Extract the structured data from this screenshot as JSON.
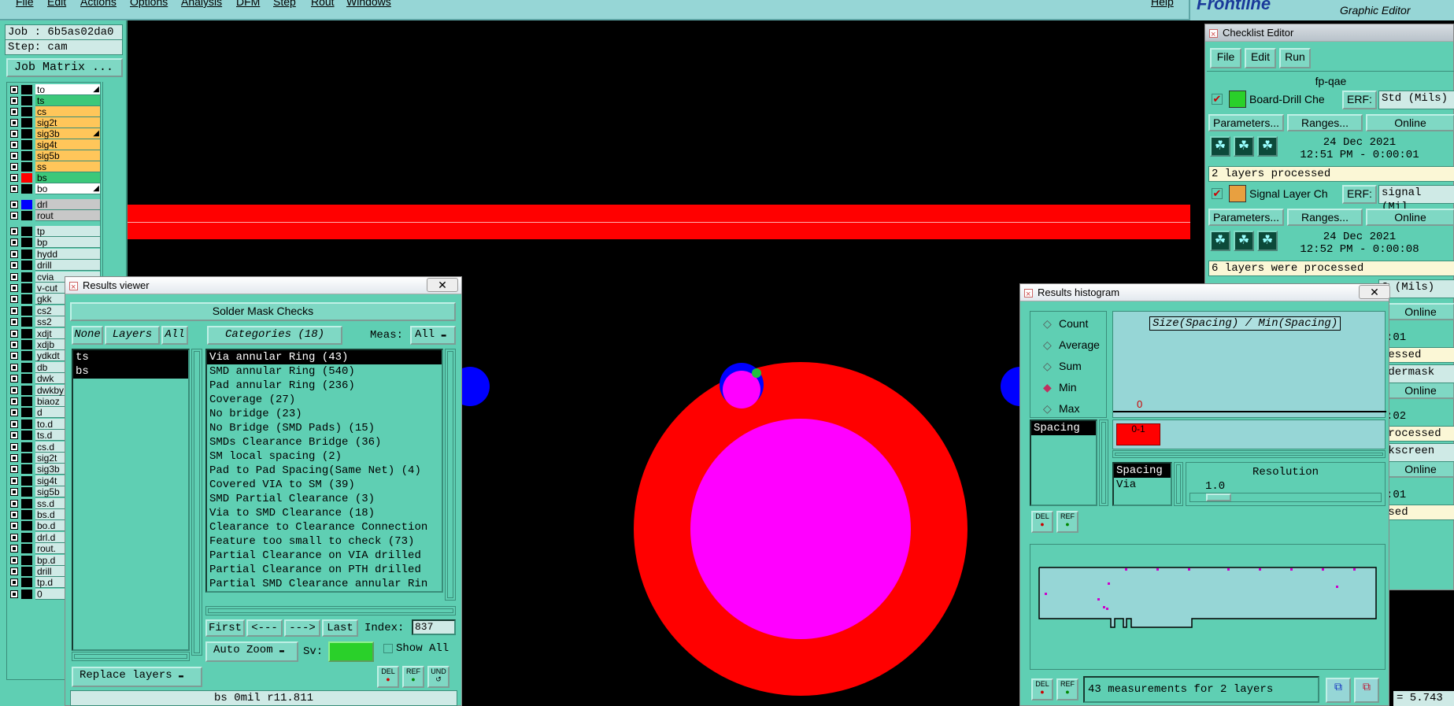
{
  "menu": [
    "File",
    "Edit",
    "Actions",
    "Options",
    "Analysis",
    "DFM",
    "Step",
    "Rout",
    "Windows",
    "Help"
  ],
  "brand": {
    "logo": "Frontline",
    "subtitle": "Graphic Editor"
  },
  "job": {
    "job_label": "Job : 6b5as02da0",
    "step_label": "Step: cam",
    "matrix_button": "Job Matrix ..."
  },
  "layers": [
    {
      "name": "to",
      "color": "#ffffff",
      "marker": "◢"
    },
    {
      "name": "ts",
      "color": "#3cc87a",
      "marker": ""
    },
    {
      "name": "cs",
      "color": "#ffc65a",
      "marker": ""
    },
    {
      "name": "sig2t",
      "color": "#ffc65a",
      "marker": ""
    },
    {
      "name": "sig3b",
      "color": "#ffc65a",
      "marker": "◢"
    },
    {
      "name": "sig4t",
      "color": "#ffc65a",
      "marker": ""
    },
    {
      "name": "sig5b",
      "color": "#ffc65a",
      "marker": ""
    },
    {
      "name": "ss",
      "color": "#ffc65a",
      "marker": ""
    },
    {
      "name": "bs",
      "color": "#3cc87a",
      "marker": ""
    },
    {
      "name": "bo",
      "color": "#ffffff",
      "marker": "◢"
    }
  ],
  "drill_layers": [
    {
      "name": "drl",
      "color": "#c8c8c8"
    },
    {
      "name": "rout",
      "color": "#c8c8c8"
    }
  ],
  "misc_layers": [
    "tp",
    "bp",
    "hydd",
    "drill",
    "cvia",
    "v-cut",
    "gkk",
    "cs2",
    "ss2",
    "xdjt",
    "xdjb",
    "ydkdt",
    "db",
    "dwk",
    "dwkby",
    "biaoz",
    "d",
    "to.d",
    "ts.d",
    "cs.d",
    "sig2t",
    "sig3b",
    "sig4t",
    "sig5b",
    "ss.d",
    "bs.d",
    "bo.d",
    "drl.d",
    "rout.",
    "bp.d",
    "drill",
    "tp.d",
    "0"
  ],
  "results_viewer": {
    "title": "Results viewer",
    "header": "Solder Mask Checks",
    "none_btn": "None",
    "layers_btn": "Layers",
    "all_btn": "All",
    "categories_btn": "Categories (18)",
    "meas_label": "Meas:",
    "meas_value": "All",
    "layer_list": [
      "ts",
      "bs"
    ],
    "categories": [
      "Via annular Ring (43)",
      "SMD annular Ring (540)",
      "Pad annular Ring (236)",
      "Coverage (27)",
      "No bridge (23)",
      "No Bridge (SMD Pads) (15)",
      "SMDs Clearance Bridge (36)",
      "SM local spacing (2)",
      "Pad to Pad Spacing(Same Net) (4)",
      "Covered VIA to SM (39)",
      "SMD Partial Clearance (3)",
      "Via to SMD Clearance (18)",
      "Clearance to Clearance Connection",
      "Feature too small to check (73)",
      "Partial Clearance on VIA drilled",
      "Partial Clearance on PTH drilled",
      "Partial SMD Clearance annular Rin"
    ],
    "nav": {
      "first": "First",
      "prev": "<---",
      "next": "--->",
      "last": "Last",
      "index_label": "Index:",
      "index_value": "837"
    },
    "auto_zoom": "Auto Zoom",
    "sv_label": "Sv:",
    "show_all": "Show All",
    "replace_layers": "Replace layers",
    "del": "DEL",
    "ref": "REF",
    "undo": "UND",
    "status": "bs 0mil  r11.811"
  },
  "checklist": {
    "title": "Checklist Editor",
    "menu": [
      "File",
      "Edit",
      "Run"
    ],
    "name": "fp-qae",
    "items": [
      {
        "name": "Board-Drill Che",
        "erf": "ERF:",
        "erf_value": "Std (Mils)",
        "params": "Parameters...",
        "ranges": "Ranges...",
        "online": "Online",
        "date": "24 Dec 2021",
        "time": "12:51 PM - 0:00:01",
        "status": "2 layers processed",
        "icon_color": "#2ad02a"
      },
      {
        "name": "Signal Layer Ch",
        "erf": "ERF:",
        "erf_value": "signal (Mil",
        "params": "Parameters...",
        "ranges": "Ranges...",
        "online": "Online",
        "date": "24 Dec 2021",
        "time": "12:52 PM - 0:00:08",
        "status": "6 layers were processed",
        "icon_color": "#e8a040"
      }
    ],
    "partial": {
      "erf_value": "G (Mils)",
      "online": [
        "Online",
        "Online",
        "Online"
      ],
      "time_a": ":01",
      "status_a": "cessed",
      "status_b": "ldermask",
      "time_b": ":02",
      "status_c": "processed",
      "status_d": "lkscreen",
      "time_c": ":01",
      "status_e": "ssed",
      "readout": "= 5.743"
    }
  },
  "histogram": {
    "title": "Results histogram",
    "modes": [
      {
        "label": "Count",
        "on": false
      },
      {
        "label": "Average",
        "on": false
      },
      {
        "label": "Sum",
        "on": false
      },
      {
        "label": "Min",
        "on": true
      },
      {
        "label": "Max",
        "on": false
      }
    ],
    "measure_list": [
      "Spacing"
    ],
    "chart_title": "Size(Spacing) / Min(Spacing)",
    "bin_count": "0",
    "bin_label": "0-1",
    "type_list": [
      "Spacing",
      "Via"
    ],
    "resolution_label": "Resolution",
    "resolution_value": "1.0",
    "summary": "43 measurements for 2 layers",
    "del": "DEL",
    "ref": "REF"
  }
}
